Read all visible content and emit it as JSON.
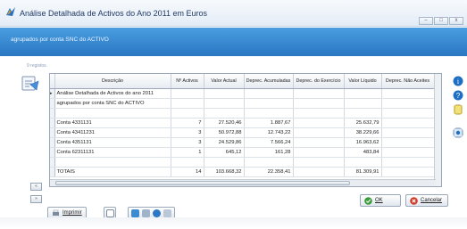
{
  "window": {
    "title": "Análise Detalhada de Activos do Ano 2011 em Euros",
    "buttons": [
      "–",
      "□",
      "x"
    ]
  },
  "banner": {
    "text": "agrupados por conta SNC do ACTIVO"
  },
  "records": {
    "text": "9 registos."
  },
  "table": {
    "columns": [
      "Descrição",
      "Nº Activos",
      "Valor Actual",
      "Deprec. Acumuladas",
      "Deprec. do Exercício",
      "Valor Líquido",
      "Deprec. Não Aceites"
    ],
    "rows": [
      [
        "Análise Detalhada de Activos do ano 2011",
        "",
        "",
        "",
        "",
        "",
        ""
      ],
      [
        "agrupados por conta SNC do ACTIVO",
        "",
        "",
        "",
        "",
        "",
        ""
      ],
      [
        "",
        "",
        "",
        "",
        "",
        "",
        ""
      ],
      [
        "Conta 4331131",
        "7",
        "27.520,46",
        "1.887,67",
        "",
        "25.632,79",
        ""
      ],
      [
        "Conta 43411231",
        "3",
        "50.972,88",
        "12.743,22",
        "",
        "38.229,66",
        ""
      ],
      [
        "Conta 4351131",
        "3",
        "24.529,86",
        "7.566,24",
        "",
        "16.963,62",
        ""
      ],
      [
        "Conta 62311131",
        "1",
        "645,12",
        "161,28",
        "",
        "483,84",
        ""
      ],
      [
        "",
        "",
        "",
        "",
        "",
        "",
        ""
      ],
      [
        "TOTAIS",
        "14",
        "103.668,32",
        "22.358,41",
        "",
        "81.309,91",
        ""
      ]
    ]
  },
  "buttons": {
    "print": "Imprimir",
    "ok": "OK",
    "cancel": "Cancelar"
  },
  "colors": {
    "banner": "#2f7fca",
    "title_text": "#223a66",
    "accent_green": "#3a9b3a",
    "accent_red": "#d23a2a",
    "accent_blue": "#1e6fc4"
  }
}
